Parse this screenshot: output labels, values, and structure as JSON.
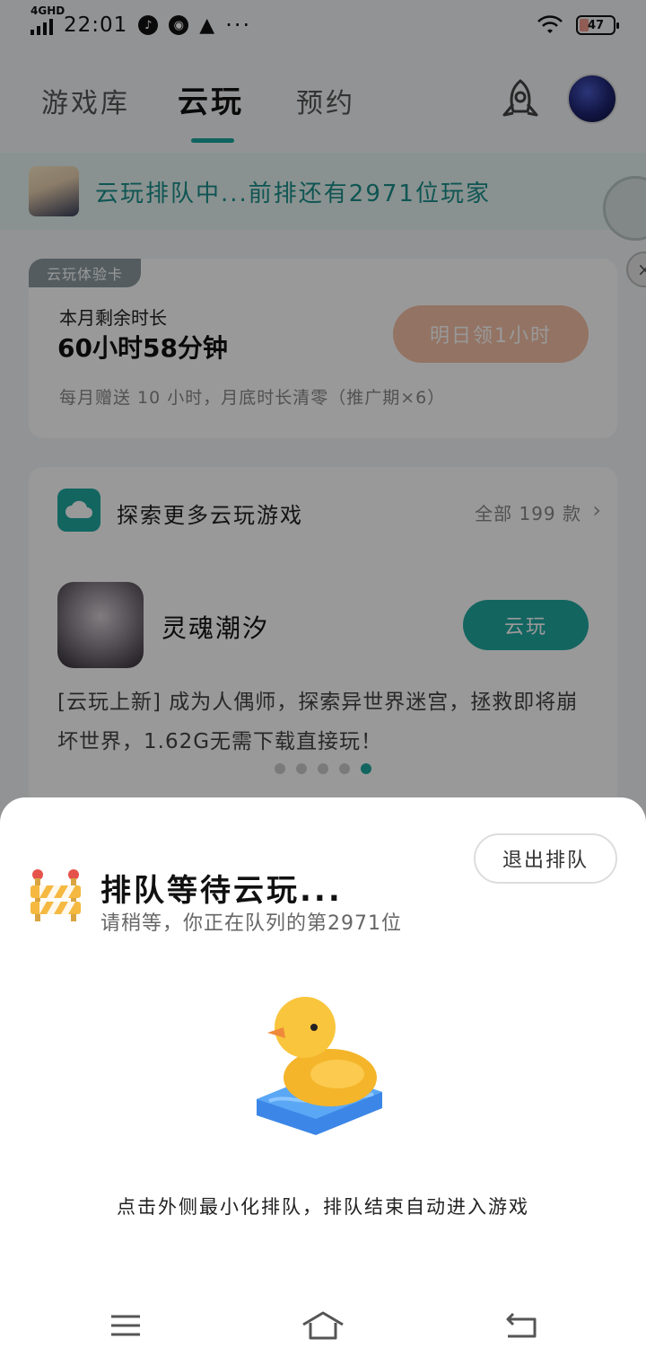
{
  "status_bar": {
    "network": "4GHD",
    "time": "22:01",
    "dots": "···",
    "battery": "47"
  },
  "nav": {
    "tabs": [
      {
        "label": "游戏库"
      },
      {
        "label": "云玩"
      },
      {
        "label": "预约"
      }
    ],
    "active_tab": "云玩"
  },
  "queue_banner": {
    "text": "云玩排队中...前排还有2971位玩家"
  },
  "trial_card": {
    "tag": "云玩体验卡",
    "remaining_label": "本月剩余时长",
    "remaining_value": "60小时58分钟",
    "claim_button": "明日领1小时",
    "note": "每月赠送 10 小时，月底时长清零（推广期×6）"
  },
  "explore": {
    "title": "探索更多云玩游戏",
    "all_link": "全部 199 款",
    "game": {
      "name": "灵魂潮汐",
      "play_button": "云玩",
      "description": "[云玩上新] 成为人偶师，探索异世界迷宫，拯救即将崩坏世界，1.62G无需下载直接玩！"
    },
    "pager": {
      "count": 5,
      "active_index": 4
    }
  },
  "sheet": {
    "title": "排队等待云玩...",
    "subtitle": "请稍等，你正在队列的第2971位",
    "exit_button": "退出排队",
    "hint": "点击外侧最小化排队，排队结束自动进入游戏"
  },
  "colors": {
    "accent": "#21a9a1",
    "claim": "#f6c0a6",
    "banner_bg": "#e4f3f1"
  }
}
